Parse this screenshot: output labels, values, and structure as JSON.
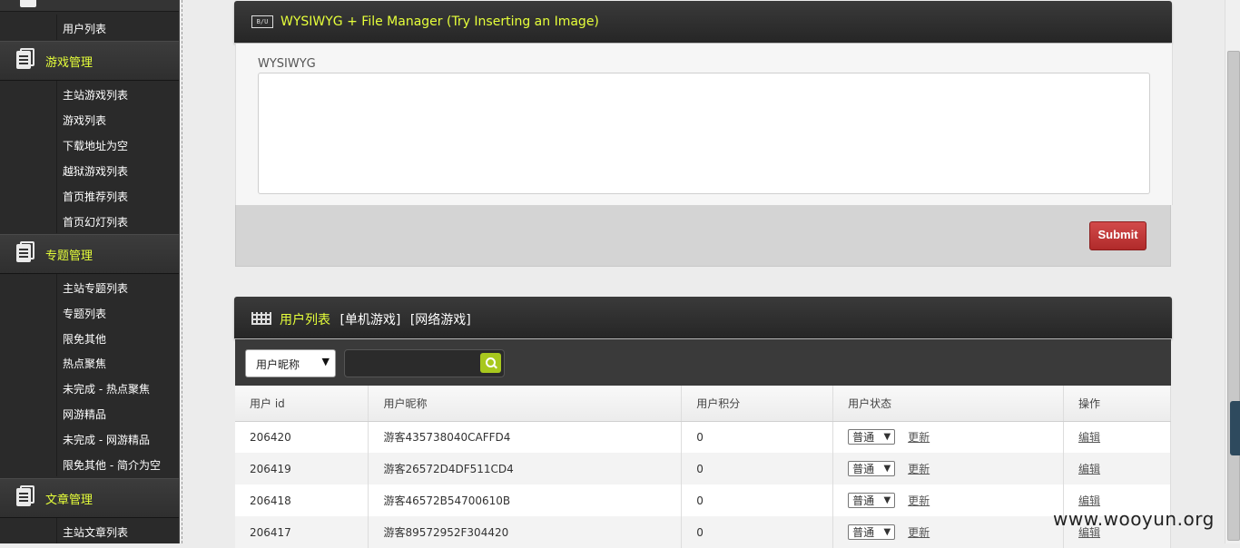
{
  "sidebar": {
    "sections": [
      {
        "label": "游戏管理",
        "items": [
          "主站游戏列表",
          "游戏列表",
          "下载地址为空",
          "越狱游戏列表",
          "首页推荐列表",
          "首页幻灯列表"
        ]
      },
      {
        "label": "专题管理",
        "items": [
          "主站专题列表",
          "专题列表",
          "限免其他",
          "热点聚焦",
          "未完成 - 热点聚焦",
          "网游精品",
          "未完成 - 网游精品",
          "限免其他 - 简介为空"
        ]
      },
      {
        "label": "文章管理",
        "items": [
          "主站文章列表"
        ]
      }
    ],
    "top_item": "用户列表"
  },
  "wysiwyg_panel": {
    "icon_text": "B/U",
    "title": "WYSIWYG + File Manager (Try Inserting an Image)",
    "field_label": "WYSIWYG",
    "submit_label": "Submit"
  },
  "user_panel": {
    "tabs": [
      "用户列表",
      "[单机游戏]",
      "[网络游戏]"
    ],
    "filter_selected": "用户昵称",
    "search_value": "",
    "columns": [
      "用户 id",
      "用户昵称",
      "用户积分",
      "用户状态",
      "操作"
    ],
    "rows": [
      {
        "id": "206420",
        "nick": "游客435738040CAFFD4",
        "score": "0",
        "status": "普通",
        "update": "更新",
        "edit": "编辑"
      },
      {
        "id": "206419",
        "nick": "游客26572D4DF511CD4",
        "score": "0",
        "status": "普通",
        "update": "更新",
        "edit": "编辑"
      },
      {
        "id": "206418",
        "nick": "游客46572B54700610B",
        "score": "0",
        "status": "普通",
        "update": "更新",
        "edit": "编辑"
      },
      {
        "id": "206417",
        "nick": "游客89572952F304420",
        "score": "0",
        "status": "普通",
        "update": "更新",
        "edit": "编辑"
      }
    ]
  },
  "watermark": "www.wooyun.org",
  "colors": {
    "accent": "#e6ff3a",
    "submit": "#c23a3a",
    "search_button": "#a8c81e"
  }
}
